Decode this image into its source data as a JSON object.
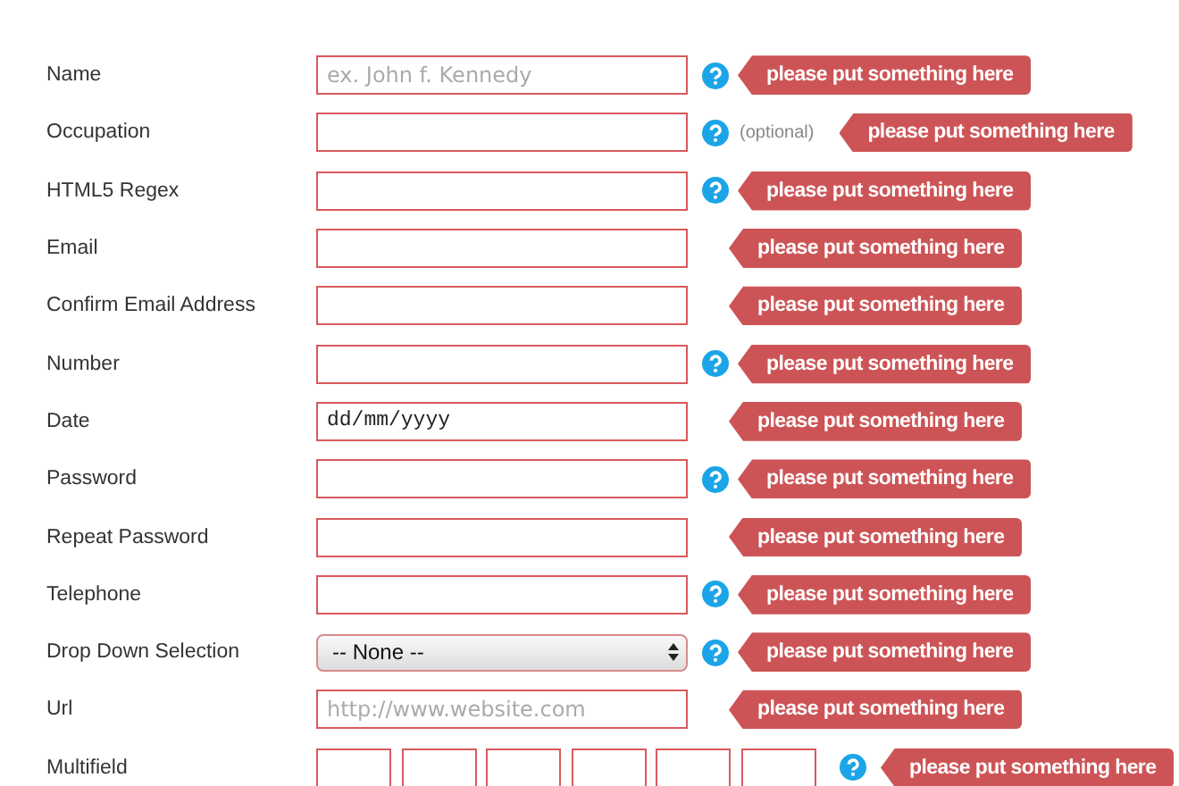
{
  "rows": [
    {
      "kind": "field",
      "label": "Name",
      "placeholder": "ex. John f. Kennedy",
      "help": true,
      "error": "please put something here"
    },
    {
      "kind": "field",
      "label": "Occupation",
      "help": true,
      "note": "(optional)",
      "error": "please put something here"
    },
    {
      "kind": "field",
      "label": "HTML5 Regex",
      "help": true,
      "error": "please put something here"
    },
    {
      "kind": "field",
      "label": "Email",
      "help": false,
      "error": "please put something here"
    },
    {
      "kind": "field",
      "label": "Confirm Email Address",
      "help": false,
      "error": "please put something here"
    },
    {
      "kind": "field",
      "label": "Number",
      "help": true,
      "error": "please put something here"
    },
    {
      "kind": "date",
      "label": "Date",
      "value": "dd/mm/yyyy",
      "help": false,
      "error": "please put something here"
    },
    {
      "kind": "field",
      "label": "Password",
      "help": true,
      "error": "please put something here"
    },
    {
      "kind": "field",
      "label": "Repeat Password",
      "help": false,
      "error": "please put something here"
    },
    {
      "kind": "field",
      "label": "Telephone",
      "help": true,
      "error": "please put something here"
    },
    {
      "kind": "select",
      "label": "Drop Down Selection",
      "value": "-- None --",
      "help": true,
      "error": "please put something here"
    },
    {
      "kind": "field",
      "label": "Url",
      "placeholder": "http://www.website.com",
      "help": false,
      "error": "please put something here"
    },
    {
      "kind": "multi",
      "label": "Multifield",
      "help": true,
      "error": "please put something here"
    }
  ]
}
